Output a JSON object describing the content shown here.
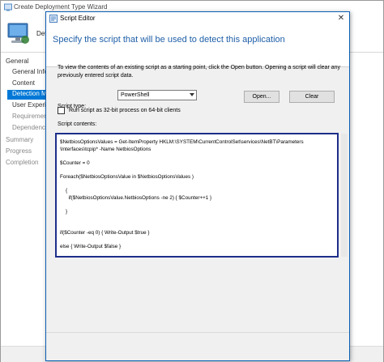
{
  "wizard": {
    "title": "Create Deployment Type Wizard",
    "header_text": "Det",
    "nav": [
      {
        "label": "General",
        "level": 0,
        "state": "normal"
      },
      {
        "label": "General Informat",
        "level": 1,
        "state": "normal"
      },
      {
        "label": "Content",
        "level": 1,
        "state": "normal"
      },
      {
        "label": "Detection Me",
        "level": 1,
        "state": "selected"
      },
      {
        "label": "User Experience",
        "level": 1,
        "state": "normal"
      },
      {
        "label": "Requirements",
        "level": 1,
        "state": "dim"
      },
      {
        "label": "Dependencies",
        "level": 1,
        "state": "dim"
      },
      {
        "label": "Summary",
        "level": 0,
        "state": "dim"
      },
      {
        "label": "Progress",
        "level": 0,
        "state": "dim"
      },
      {
        "label": "Completion",
        "level": 0,
        "state": "dim"
      }
    ]
  },
  "dialog": {
    "title": "Script Editor",
    "close_glyph": "✕",
    "heading": "Specify the script that will be used to detect this application",
    "description": "To view the contents of an existing script as a starting point, click the Open button. Opening a script will clear any previously entered script data.",
    "script_type_label": "Script type:",
    "script_type_value": "PowerShell",
    "open_button": "Open...",
    "clear_button": "Clear",
    "checkbox_label": "Run script as 32-bit process on 64-bit clients",
    "checkbox_checked": false,
    "contents_label": "Script contents:",
    "script_lines": [
      "$NetbiosOptionsValues = Get-ItemProperty HKLM:\\SYSTEM\\CurrentControlSet\\services\\NetBT\\Parameters",
      "\\Interfaces\\tcpip* -Name NetbiosOptions",
      "",
      "$Counter = 0",
      "",
      "Foreach($NetbiosOptionsValue in $NetbiosOptionsValues )",
      "",
      "    {",
      "      if($NetbiosOptionsValue.NetbiosOptions -ne 2) { $Counter++1 }",
      "",
      "    }",
      "",
      "",
      "if($Counter -eq 0) { Write-Output $true }",
      "",
      "else { Write-Output $false }"
    ]
  },
  "colors": {
    "heading": "#1f5fa8",
    "selected_nav": "#0078d7",
    "script_border": "#1d2f8a"
  }
}
